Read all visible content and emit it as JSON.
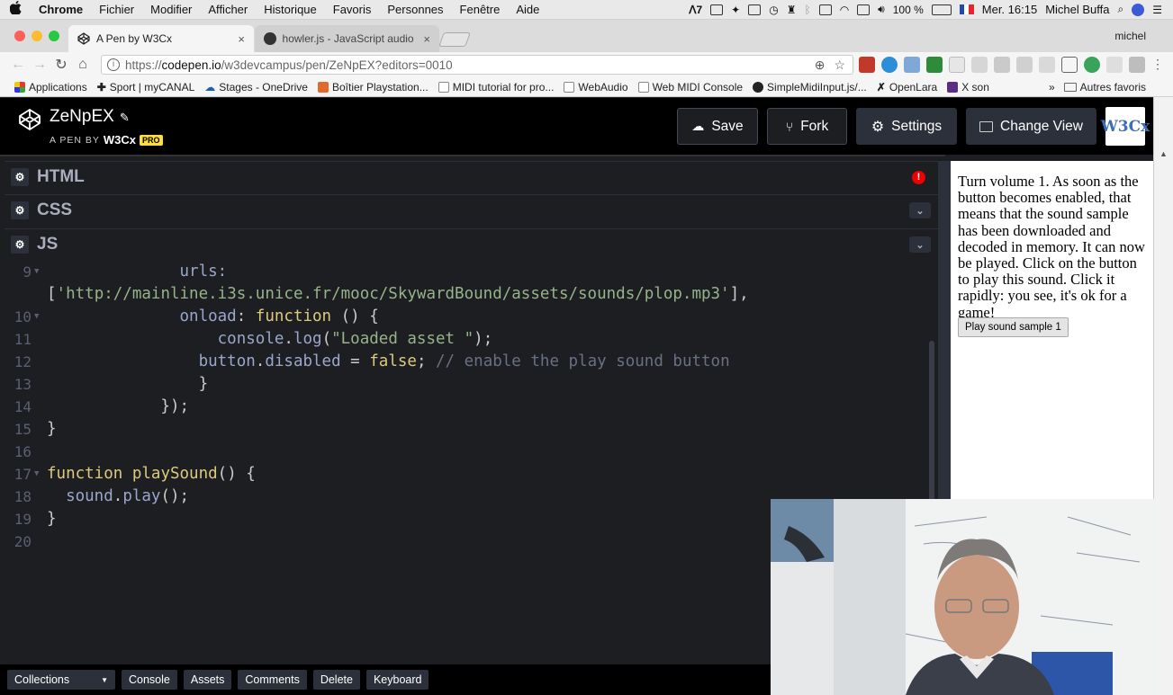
{
  "menubar": {
    "apple": "",
    "app": "Chrome",
    "items": [
      "Fichier",
      "Modifier",
      "Afficher",
      "Historique",
      "Favoris",
      "Personnes",
      "Fenêtre",
      "Aide"
    ],
    "status_text": "7",
    "battery": "100 %",
    "clock": "Mer. 16:15",
    "user": "Michel Buffa"
  },
  "tabs": [
    {
      "title": "A Pen by W3Cx",
      "close": "×"
    },
    {
      "title": "howler.js - JavaScript audio lib",
      "close": "×"
    }
  ],
  "profile": "michel",
  "toolbar": {
    "url_prefix": "https://",
    "url_domain": "codepen.io",
    "url_path": "/w3devcampus/pen/ZeNpEX?editors=0010"
  },
  "bookmarks": {
    "items": [
      "Applications",
      "Sport | myCANAL",
      "Stages - OneDrive",
      "Boîtier Playstation...",
      "MIDI tutorial for pro...",
      "WebAudio",
      "Web MIDI Console",
      "SimpleMidiInput.js/...",
      "OpenLara",
      "X son"
    ],
    "more": "»",
    "other": "Autres favoris"
  },
  "codepen": {
    "pen_title": "ZeNpEX",
    "pen_by": "A PEN BY",
    "author": "W3Cx",
    "pro_badge": "PRO",
    "buttons": {
      "save": "Save",
      "fork": "Fork",
      "settings": "Settings",
      "change_view": "Change View"
    },
    "avatar_text": "W3Cx"
  },
  "panes": {
    "html": "HTML",
    "css": "CSS",
    "js": "JS",
    "error_mark": "!"
  },
  "code_lines": [
    {
      "n": "9",
      "fold": true,
      "parts": [
        {
          "t": "              urls:",
          "c": "prop"
        }
      ]
    },
    {
      "n": "",
      "fold": false,
      "parts": [
        {
          "t": "[",
          "c": "punc"
        },
        {
          "t": "'http://mainline.i3s.unice.fr/mooc/SkywardBound/assets/sounds/plop.mp3'",
          "c": "str"
        },
        {
          "t": "],",
          "c": "punc"
        }
      ]
    },
    {
      "n": "10",
      "fold": true,
      "parts": [
        {
          "t": "              onload",
          "c": "prop"
        },
        {
          "t": ": ",
          "c": "punc"
        },
        {
          "t": "function",
          "c": "kw"
        },
        {
          "t": " () {",
          "c": "punc"
        }
      ]
    },
    {
      "n": "11",
      "fold": false,
      "parts": [
        {
          "t": "                  console",
          "c": "prop"
        },
        {
          "t": ".",
          "c": "punc"
        },
        {
          "t": "log",
          "c": "prop"
        },
        {
          "t": "(",
          "c": "punc"
        },
        {
          "t": "\"Loaded asset \"",
          "c": "str"
        },
        {
          "t": ");",
          "c": "punc"
        }
      ]
    },
    {
      "n": "12",
      "fold": false,
      "parts": [
        {
          "t": "                button",
          "c": "prop"
        },
        {
          "t": ".",
          "c": "punc"
        },
        {
          "t": "disabled",
          "c": "prop"
        },
        {
          "t": " = ",
          "c": "punc"
        },
        {
          "t": "false",
          "c": "kw"
        },
        {
          "t": "; ",
          "c": "punc"
        },
        {
          "t": "// enable the play sound button",
          "c": "cmt"
        }
      ]
    },
    {
      "n": "13",
      "fold": false,
      "parts": [
        {
          "t": "                }",
          "c": "punc"
        }
      ]
    },
    {
      "n": "14",
      "fold": false,
      "parts": [
        {
          "t": "            });",
          "c": "punc"
        }
      ]
    },
    {
      "n": "15",
      "fold": false,
      "parts": [
        {
          "t": "}",
          "c": "punc"
        }
      ]
    },
    {
      "n": "16",
      "fold": false,
      "parts": [
        {
          "t": "",
          "c": "punc"
        }
      ]
    },
    {
      "n": "17",
      "fold": true,
      "parts": [
        {
          "t": "function",
          "c": "kw"
        },
        {
          "t": " ",
          "c": "punc"
        },
        {
          "t": "playSound",
          "c": "fn"
        },
        {
          "t": "() {",
          "c": "punc"
        }
      ]
    },
    {
      "n": "18",
      "fold": false,
      "parts": [
        {
          "t": "  sound",
          "c": "prop"
        },
        {
          "t": ".",
          "c": "punc"
        },
        {
          "t": "play",
          "c": "prop"
        },
        {
          "t": "();",
          "c": "punc"
        }
      ]
    },
    {
      "n": "19",
      "fold": false,
      "parts": [
        {
          "t": "}",
          "c": "punc"
        }
      ]
    },
    {
      "n": "20",
      "fold": false,
      "parts": [
        {
          "t": "",
          "c": "punc"
        }
      ]
    }
  ],
  "preview": {
    "text": "Turn volume 1. As soon as the button becomes enabled, that means that the sound sample has been downloaded and decoded in memory. It can now be played. Click on the button to play this sound. Click it rapidly: you see, it's ok for a game!",
    "button": "Play sound sample 1"
  },
  "footer": {
    "collections": "Collections",
    "collections_arrow": "▼",
    "buttons": [
      "Console",
      "Assets",
      "Comments",
      "Delete",
      "Keyboard"
    ]
  },
  "colors": {
    "editor_bg": "#1d1e22",
    "keyword": "#ddca7e",
    "string": "#96b38a",
    "property": "#9ba7ca",
    "comment": "#6a7083"
  }
}
